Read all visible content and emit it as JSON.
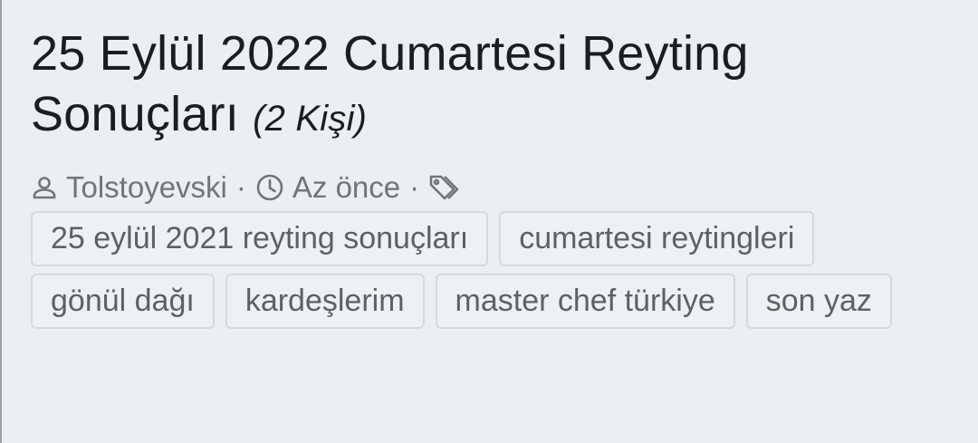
{
  "post": {
    "title": "25 Eylül 2022 Cumartesi Reyting Sonuçları",
    "viewer_count": "(2 Kişi)",
    "meta": {
      "author": "Tolstoyevski",
      "time": "Az önce",
      "separator": "·"
    },
    "tags": [
      "25 eylül 2021 reyting sonuçları",
      "cumartesi reytingleri",
      "gönül dağı",
      "kardeşlerim",
      "master chef türkiye",
      "son yaz"
    ]
  },
  "icons": {
    "author": "user-icon",
    "time": "clock-icon",
    "tags": "tag-icon"
  },
  "colors": {
    "background": "#eceff2",
    "title": "#1b1d1f",
    "meta": "#70757a",
    "tag_border": "#d6dade"
  }
}
